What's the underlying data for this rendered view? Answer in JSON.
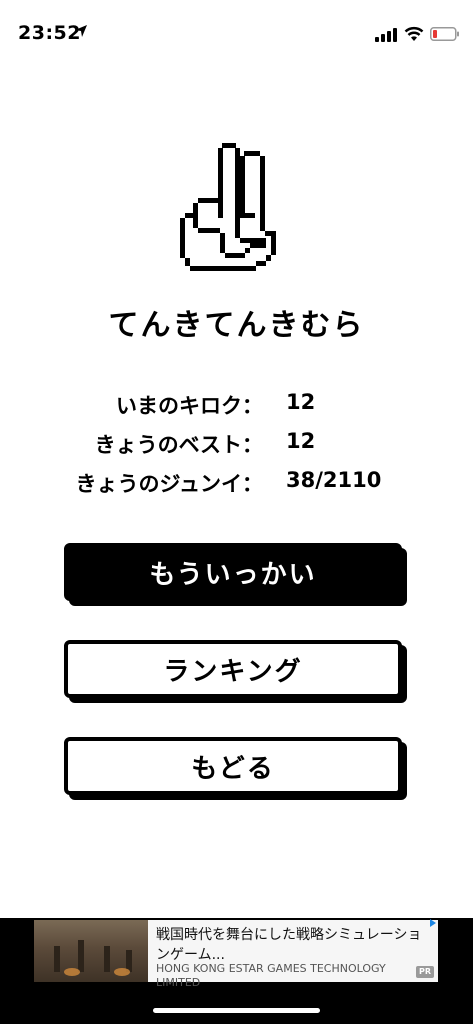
{
  "status": {
    "time": "23:52"
  },
  "app": {
    "title": "てんきてんきむら"
  },
  "stats": [
    {
      "label": "いまのキロク：",
      "value": "12"
    },
    {
      "label": "きょうのベスト：",
      "value": "12"
    },
    {
      "label": "きょうのジュンイ：",
      "value": "38/2110"
    }
  ],
  "buttons": {
    "retry": "もういっかい",
    "ranking": "ランキング",
    "back": "もどる"
  },
  "ad": {
    "title": "戦国時代を舞台にした戦略シミュレーションゲーム...",
    "advertiser": "HONG KONG ESTAR GAMES TECHNOLOGY LIMITED",
    "badge": "PR"
  },
  "colors": {
    "primary": "#000000",
    "background": "#ffffff",
    "battery_low": "#e53935"
  }
}
